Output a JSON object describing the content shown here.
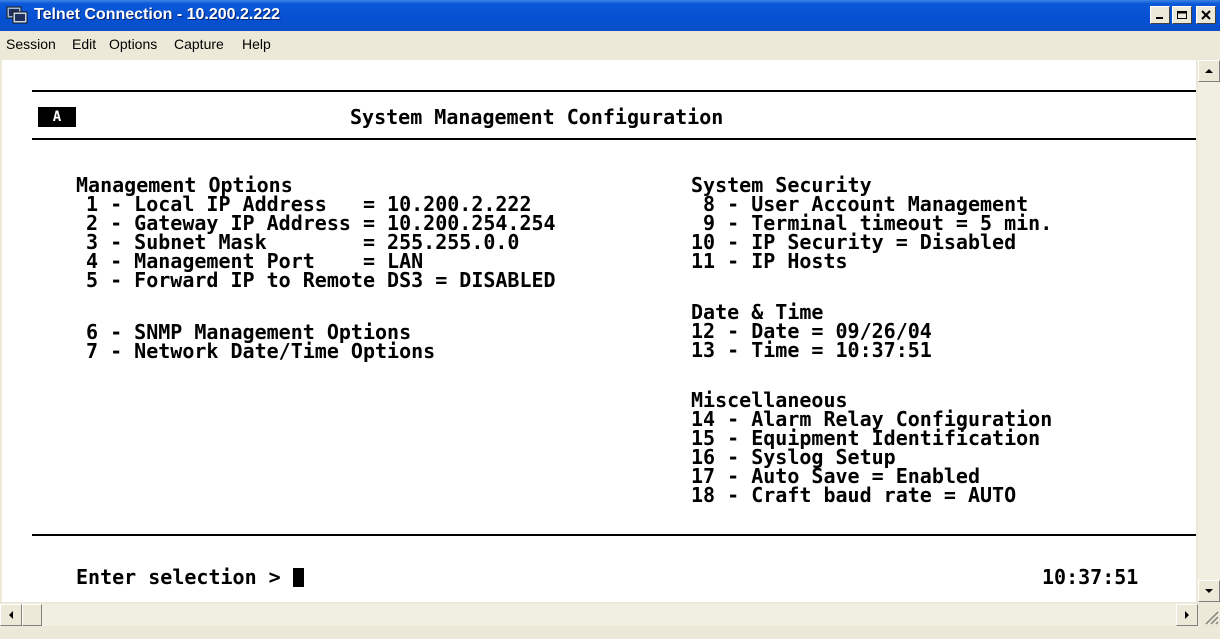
{
  "window": {
    "title": "Telnet Connection - 10.200.2.222",
    "minimize_icon": "minimize-icon",
    "maximize_icon": "maximize-icon",
    "close_icon": "close-icon"
  },
  "menu": {
    "items": [
      {
        "label": "Session"
      },
      {
        "label": "Edit"
      },
      {
        "label": "Options"
      },
      {
        "label": "Capture"
      },
      {
        "label": "Help"
      }
    ]
  },
  "terminal": {
    "tag": "A",
    "title": "System Management Configuration",
    "management": {
      "heading": "Management Options",
      "items": [
        "1 - Local IP Address   = 10.200.2.222",
        "2 - Gateway IP Address = 10.200.254.254",
        "3 - Subnet Mask        = 255.255.0.0",
        "4 - Management Port    = LAN",
        "5 - Forward IP to Remote DS3 = DISABLED"
      ],
      "extra_items": [
        "6 - SNMP Management Options",
        "7 - Network Date/Time Options"
      ]
    },
    "security": {
      "heading": "System Security",
      "items": [
        " 8 - User Account Management",
        " 9 - Terminal timeout = 5 min.",
        "10 - IP Security = Disabled",
        "11 - IP Hosts"
      ]
    },
    "datetime": {
      "heading": "Date & Time",
      "items": [
        "12 - Date = 09/26/04",
        "13 - Time = 10:37:51"
      ]
    },
    "misc": {
      "heading": "Miscellaneous",
      "items": [
        "14 - Alarm Relay Configuration",
        "15 - Equipment Identification",
        "16 - Syslog Setup",
        "17 - Auto Save = Enabled",
        "18 - Craft baud rate = AUTO"
      ]
    },
    "prompt": "Enter selection > ",
    "clock": "10:37:51"
  }
}
